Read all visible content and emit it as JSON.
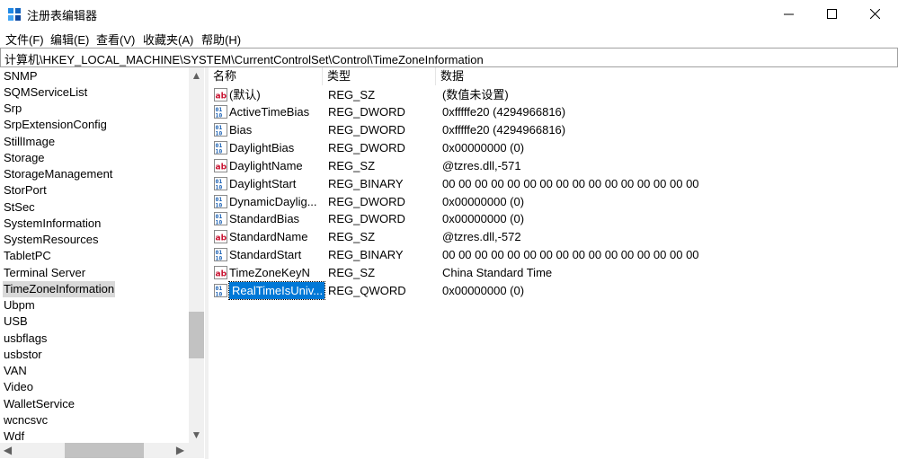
{
  "window": {
    "title": "注册表编辑器"
  },
  "menu": [
    "文件(F)",
    "编辑(E)",
    "查看(V)",
    "收藏夹(A)",
    "帮助(H)"
  ],
  "address": "计算机\\HKEY_LOCAL_MACHINE\\SYSTEM\\CurrentControlSet\\Control\\TimeZoneInformation",
  "tree": {
    "items": [
      {
        "label": "SNMP"
      },
      {
        "label": "SQMServiceList"
      },
      {
        "label": "Srp"
      },
      {
        "label": "SrpExtensionConfig"
      },
      {
        "label": "StillImage"
      },
      {
        "label": "Storage"
      },
      {
        "label": "StorageManagement"
      },
      {
        "label": "StorPort"
      },
      {
        "label": "StSec"
      },
      {
        "label": "SystemInformation"
      },
      {
        "label": "SystemResources"
      },
      {
        "label": "TabletPC"
      },
      {
        "label": "Terminal Server"
      },
      {
        "label": "TimeZoneInformation",
        "selected": true
      },
      {
        "label": "Ubpm"
      },
      {
        "label": "USB"
      },
      {
        "label": "usbflags"
      },
      {
        "label": "usbstor"
      },
      {
        "label": "VAN"
      },
      {
        "label": "Video"
      },
      {
        "label": "WalletService"
      },
      {
        "label": "wcncsvc"
      },
      {
        "label": "Wdf"
      }
    ]
  },
  "list": {
    "columns": [
      "名称",
      "类型",
      "数据"
    ],
    "rows": [
      {
        "icon": "string-value-icon",
        "name": "(默认)",
        "type": "REG_SZ",
        "data": "(数值未设置)"
      },
      {
        "icon": "binary-value-icon",
        "name": "ActiveTimeBias",
        "type": "REG_DWORD",
        "data": "0xfffffe20 (4294966816)"
      },
      {
        "icon": "binary-value-icon",
        "name": "Bias",
        "type": "REG_DWORD",
        "data": "0xfffffe20 (4294966816)"
      },
      {
        "icon": "binary-value-icon",
        "name": "DaylightBias",
        "type": "REG_DWORD",
        "data": "0x00000000 (0)"
      },
      {
        "icon": "string-value-icon",
        "name": "DaylightName",
        "type": "REG_SZ",
        "data": "@tzres.dll,-571"
      },
      {
        "icon": "binary-value-icon",
        "name": "DaylightStart",
        "type": "REG_BINARY",
        "data": "00 00 00 00 00 00 00 00 00 00 00 00 00 00 00 00"
      },
      {
        "icon": "binary-value-icon",
        "name": "DynamicDaylig...",
        "type": "REG_DWORD",
        "data": "0x00000000 (0)"
      },
      {
        "icon": "binary-value-icon",
        "name": "StandardBias",
        "type": "REG_DWORD",
        "data": "0x00000000 (0)"
      },
      {
        "icon": "string-value-icon",
        "name": "StandardName",
        "type": "REG_SZ",
        "data": "@tzres.dll,-572"
      },
      {
        "icon": "binary-value-icon",
        "name": "StandardStart",
        "type": "REG_BINARY",
        "data": "00 00 00 00 00 00 00 00 00 00 00 00 00 00 00 00"
      },
      {
        "icon": "string-value-icon",
        "name": "TimeZoneKeyN",
        "type": "REG_SZ",
        "data": "China Standard Time"
      },
      {
        "icon": "binary-value-icon",
        "name": "RealTimeIsUniv...",
        "type": "REG_QWORD",
        "data": "0x00000000 (0)",
        "selected": true
      }
    ]
  },
  "colors": {
    "selection": "#0078d7",
    "tree_selection": "#d9d9d9",
    "string_icon_red": "#c8102e",
    "binary_icon_blue": "#1e63b5"
  }
}
